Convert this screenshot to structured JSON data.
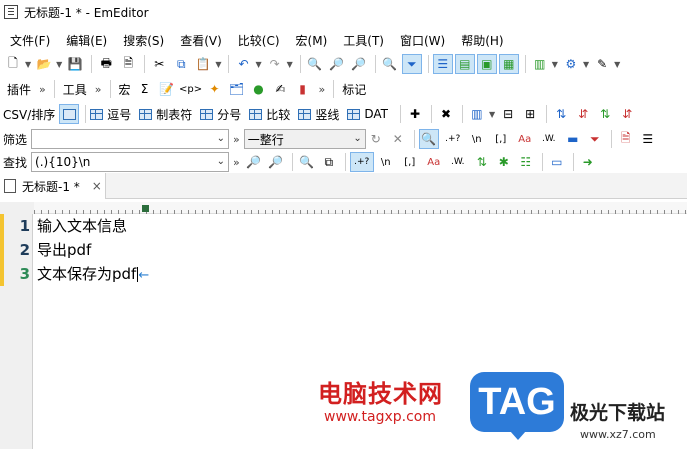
{
  "window": {
    "title": "无标题-1 * - EmEditor"
  },
  "menu": [
    "文件(F)",
    "编辑(E)",
    "搜索(S)",
    "查看(V)",
    "比较(C)",
    "宏(M)",
    "工具(T)",
    "窗口(W)",
    "帮助(H)"
  ],
  "toolbar2": {
    "plugins_label": "插件",
    "tools_label": "工具",
    "macro_label": "宏",
    "sigma": "Σ",
    "tag": "<p>",
    "marks_label": "标记"
  },
  "toolbar3": {
    "csv_label": "CSV/排序",
    "buttons": [
      "逗号",
      "制表符",
      "分号",
      "比较",
      "竖线",
      "DAT"
    ]
  },
  "filter": {
    "label": "筛选",
    "value": "",
    "mode": "一整行",
    "regex_label": ".+?",
    "newline_label": "\\n",
    "bracket_label": "[,]",
    "case_label": "Aa",
    "word_label": ".W."
  },
  "find": {
    "label": "查找",
    "value": "(.){10}\\n",
    "regex_label": ".+?",
    "newline_label": "\\n",
    "bracket_label": "[,]",
    "case_label": "Aa",
    "word_label": ".W."
  },
  "tabs": [
    {
      "label": "无标题-1 *",
      "close": "×"
    }
  ],
  "editor": {
    "line_numbers": [
      "1",
      "2",
      "3"
    ],
    "lines": [
      "输入文本信息",
      "导出pdf",
      "文本保存为pdf"
    ],
    "eol_mark": "←"
  },
  "watermark": {
    "cn_text": "电脑技术网",
    "url": "www.tagxp.com",
    "logo_text": "TAG",
    "site_name": "极光下载站",
    "site_url": "www.xz7.com"
  }
}
